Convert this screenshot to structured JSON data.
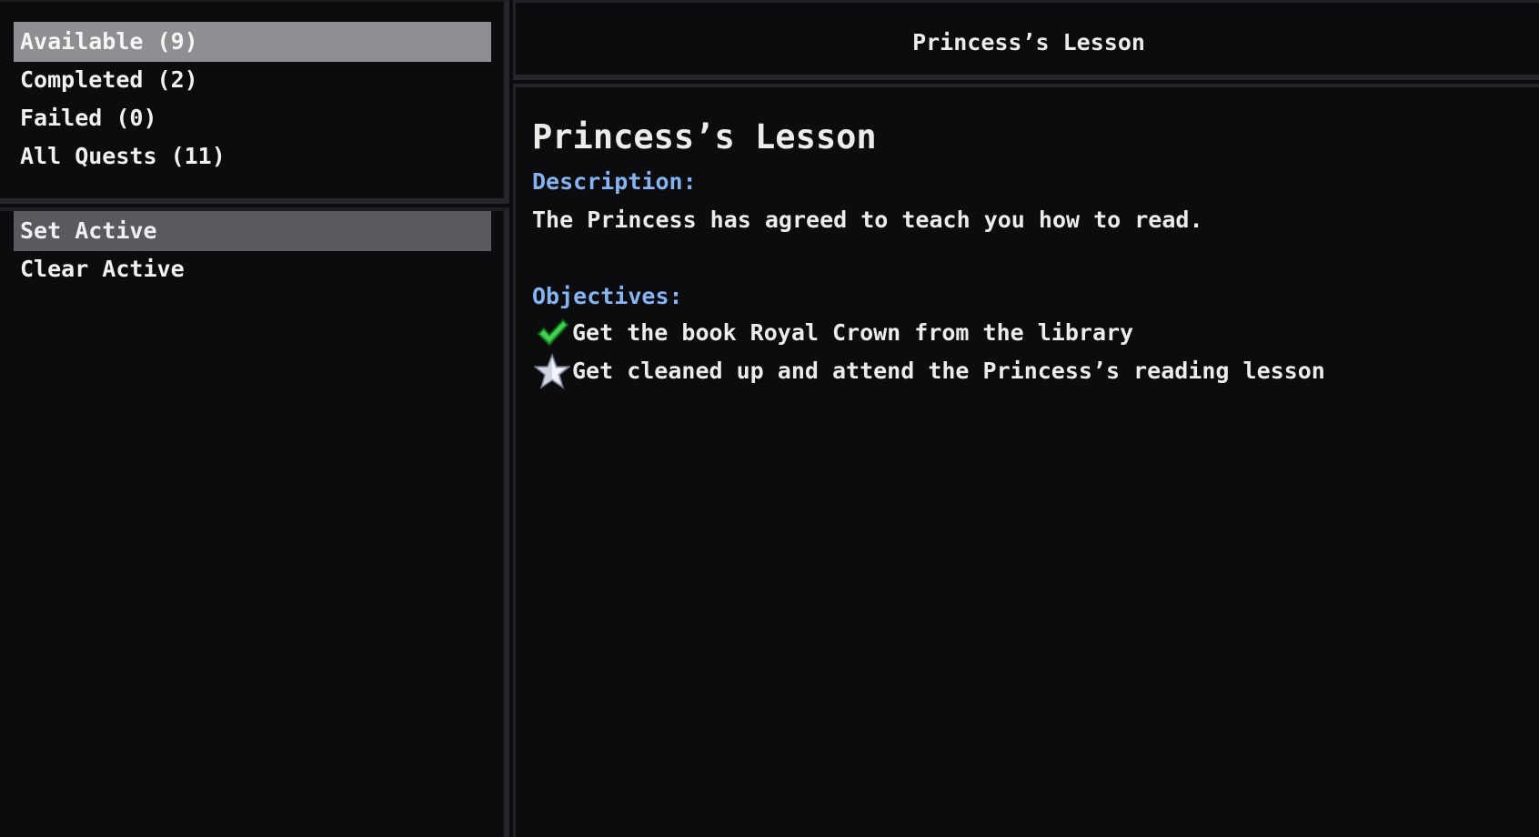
{
  "filters": {
    "items": [
      {
        "label": "Available (9)"
      },
      {
        "label": "Completed (2)"
      },
      {
        "label": "Failed (0)"
      },
      {
        "label": "All Quests (11)"
      }
    ],
    "selected_index": 0
  },
  "actions": {
    "items": [
      {
        "label": "Set Active"
      },
      {
        "label": "Clear Active"
      }
    ],
    "selected_index": 0
  },
  "header": {
    "title": "Princess’s Lesson"
  },
  "quest": {
    "title": "Princess’s Lesson",
    "description_label": "Description:",
    "description": "The Princess has agreed to teach you how to read.",
    "objectives_label": "Objectives:",
    "objectives": [
      {
        "text": "Get the book Royal Crown from the library",
        "status": "completed",
        "icon": "checkmark-icon"
      },
      {
        "text": "Get cleaned up and attend the Princess’s reading lesson",
        "status": "active",
        "icon": "star-icon"
      }
    ]
  },
  "colors": {
    "background": "#0c0b0e",
    "section_label": "#86b4f2",
    "selected_filter": "#8f8f93",
    "selected_action": "#5a595f",
    "check_green": "#2fbf3b"
  }
}
